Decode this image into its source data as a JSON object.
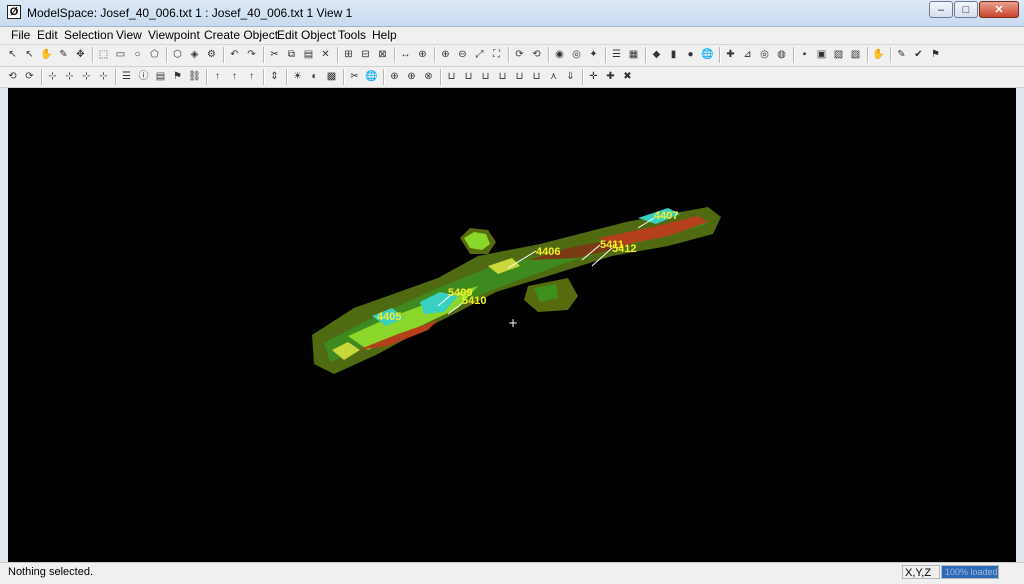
{
  "window": {
    "title": "ModelSpace: Josef_40_006.txt 1 : Josef_40_006.txt 1 View 1",
    "app_icon_glyph": "Ø",
    "controls": {
      "minimize": "–",
      "maximize": "□",
      "close": "✕"
    }
  },
  "menu": [
    {
      "label": "File"
    },
    {
      "label": "Edit"
    },
    {
      "label": "Selection"
    },
    {
      "label": "View"
    },
    {
      "label": "Viewpoint"
    },
    {
      "label": "Create Object"
    },
    {
      "label": "Edit Object"
    },
    {
      "label": "Tools"
    },
    {
      "label": "Help"
    }
  ],
  "toolbar1_icons": [
    "select-arrow-icon",
    "select-plus-icon",
    "pan-hand-icon",
    "pencil-icon",
    "move-cross-icon",
    "fence-select-icon",
    "rect-select-icon",
    "circle-select-icon",
    "polygon-select-icon",
    "box-3d-icon",
    "cube-icon",
    "scissors-axis-icon",
    "undo-icon",
    "redo-icon",
    "cut-icon",
    "copy-icon",
    "paste-icon",
    "delete-icon",
    "group-icon",
    "ungroup-icon",
    "merge-icon",
    "measure-icon",
    "zoom-region-icon",
    "zoom-in-icon",
    "zoom-out-icon",
    "zoom-fit-icon",
    "zoom-extents-icon",
    "rotate-view-icon",
    "orbit-icon",
    "layer-on-icon",
    "layer-off-icon",
    "paint-icon",
    "layers-icon",
    "layer-manager-icon",
    "fit-plane-icon",
    "fit-cylinder-icon",
    "fit-sphere-icon",
    "globe-icon",
    "registration-icon",
    "constraint-icon",
    "target-icon",
    "scan-world-icon",
    "render-point-icon",
    "render-color-icon",
    "render-intensity-icon",
    "render-texture-icon",
    "hand-grab-icon",
    "edit-pen-icon",
    "checkmark-icon",
    "flag-icon"
  ],
  "toolbar2_icons": [
    "transform-icon",
    "transform-reset-icon",
    "snap-point-icon",
    "snap-edge-icon",
    "snap-face-icon",
    "snap-center-icon",
    "list-icon",
    "object-info-icon",
    "properties-icon",
    "tag-icon",
    "link-icon",
    "rotate-x-icon",
    "rotate-y-icon",
    "rotate-z-icon",
    "axis-icon",
    "light-icon",
    "shade-icon",
    "color-map-icon",
    "segment-icon",
    "world-icon",
    "unify-icon",
    "insert-icon",
    "section-icon",
    "cutplane-1-icon",
    "cutplane-2-icon",
    "cutplane-3-icon",
    "cutplane-4-icon",
    "cutplane-5-icon",
    "cutplane-6-icon",
    "cutplane-split-icon",
    "cutplane-down-icon",
    "limit-box-icon",
    "limit-add-icon",
    "limit-remove-icon"
  ],
  "viewport": {
    "background": "#000000",
    "cursor_glyph": "+",
    "scan_labels": [
      {
        "text": "4407"
      },
      {
        "text": "4406"
      },
      {
        "text": "5411"
      },
      {
        "text": "5412"
      },
      {
        "text": "5409"
      },
      {
        "text": "5410"
      },
      {
        "text": "4405"
      }
    ]
  },
  "status": {
    "message": "Nothing selected.",
    "coords_label": "X,Y,Z",
    "progress_label": "100% loaded",
    "progress_fraction": 1.0
  },
  "colors": {
    "label": "#f5ee2a",
    "cloud_dark": "#556b0e",
    "cloud_green": "#3f8f1c",
    "cloud_bright": "#8bd62a",
    "cloud_red": "#b3401a",
    "cloud_cyan": "#39d0c0"
  }
}
